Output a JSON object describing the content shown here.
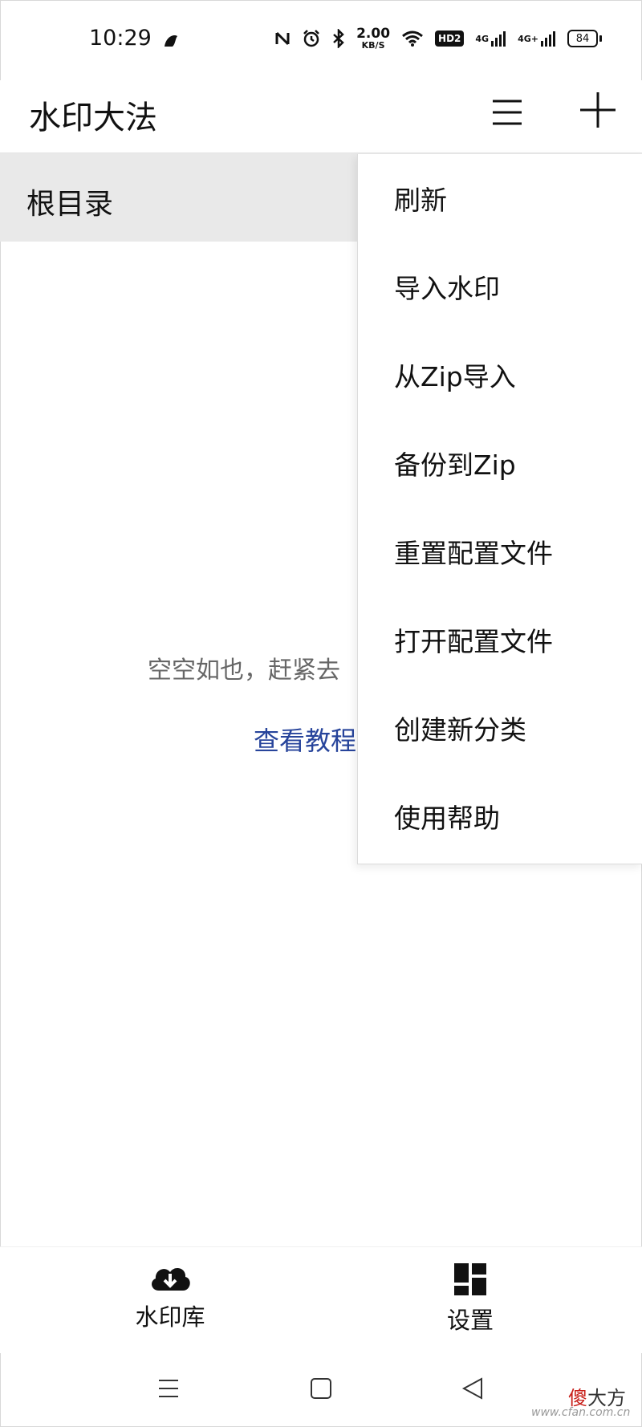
{
  "status_bar": {
    "time": "10:29",
    "net_speed_value": "2.00",
    "net_speed_unit": "KB/S",
    "hd_badge": "HD2",
    "signal_1": "4G",
    "signal_2": "4G+",
    "battery": "84"
  },
  "app_bar": {
    "title": "水印大法"
  },
  "breadcrumb": {
    "label": "根目录"
  },
  "empty_state": {
    "message": "空空如也，赶紧去",
    "link": "查看教程"
  },
  "dropdown_menu": {
    "items": [
      {
        "label": "刷新"
      },
      {
        "label": "导入水印"
      },
      {
        "label": "从Zip导入"
      },
      {
        "label": "备份到Zip"
      },
      {
        "label": "重置配置文件"
      },
      {
        "label": "打开配置文件"
      },
      {
        "label": "创建新分类"
      },
      {
        "label": "使用帮助"
      }
    ]
  },
  "bottom_nav": {
    "items": [
      {
        "label": "水印库",
        "icon": "cloud-download-icon"
      },
      {
        "label": "设置",
        "icon": "dashboard-icon"
      }
    ]
  },
  "watermark": {
    "highlight": "傻",
    "rest": "大方",
    "sub": "www.cfan.com.cn"
  },
  "colors": {
    "link": "#27449b",
    "breadcrumb_bg": "#e9e9e9",
    "watermark_highlight": "#c8201a"
  }
}
